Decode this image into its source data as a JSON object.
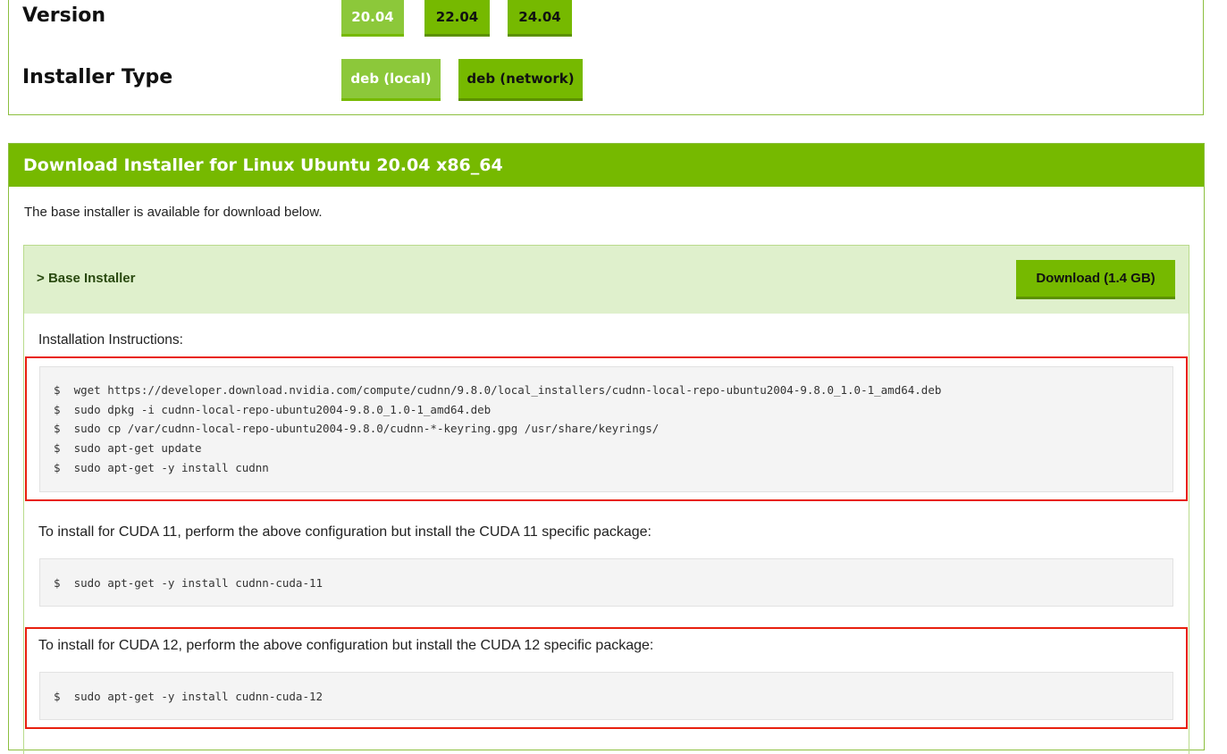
{
  "selector": {
    "version": {
      "label": "Version",
      "options": [
        "20.04",
        "22.04",
        "24.04"
      ],
      "selected": "20.04"
    },
    "installer_type": {
      "label": "Installer Type",
      "options": [
        "deb (local)",
        "deb (network)"
      ],
      "selected": "deb (local)"
    }
  },
  "download": {
    "header": "Download Installer for Linux Ubuntu 20.04 x86_64",
    "intro": "The base installer is available for download below.",
    "base_installer": {
      "chevron": ">",
      "title": "Base Installer",
      "download_label": "Download (1.4 GB)"
    },
    "instructions_label": "Installation Instructions:",
    "commands": [
      "$  wget https://developer.download.nvidia.com/compute/cudnn/9.8.0/local_installers/cudnn-local-repo-ubuntu2004-9.8.0_1.0-1_amd64.deb",
      "$  sudo dpkg -i cudnn-local-repo-ubuntu2004-9.8.0_1.0-1_amd64.deb",
      "$  sudo cp /var/cudnn-local-repo-ubuntu2004-9.8.0/cudnn-*-keyring.gpg /usr/share/keyrings/",
      "$  sudo apt-get update",
      "$  sudo apt-get -y install cudnn"
    ],
    "cuda11": {
      "label": "To install for CUDA 11, perform the above configuration but install the CUDA 11 specific package:",
      "command": "$  sudo apt-get -y install cudnn-cuda-11"
    },
    "cuda12": {
      "label": "To install for CUDA 12, perform the above configuration but install the CUDA 12 specific package:",
      "command": "$  sudo apt-get -y install cudnn-cuda-12"
    }
  },
  "colors": {
    "brand_green": "#76b900",
    "selected_green": "#8cc83a",
    "highlight_red": "#e8200e"
  }
}
